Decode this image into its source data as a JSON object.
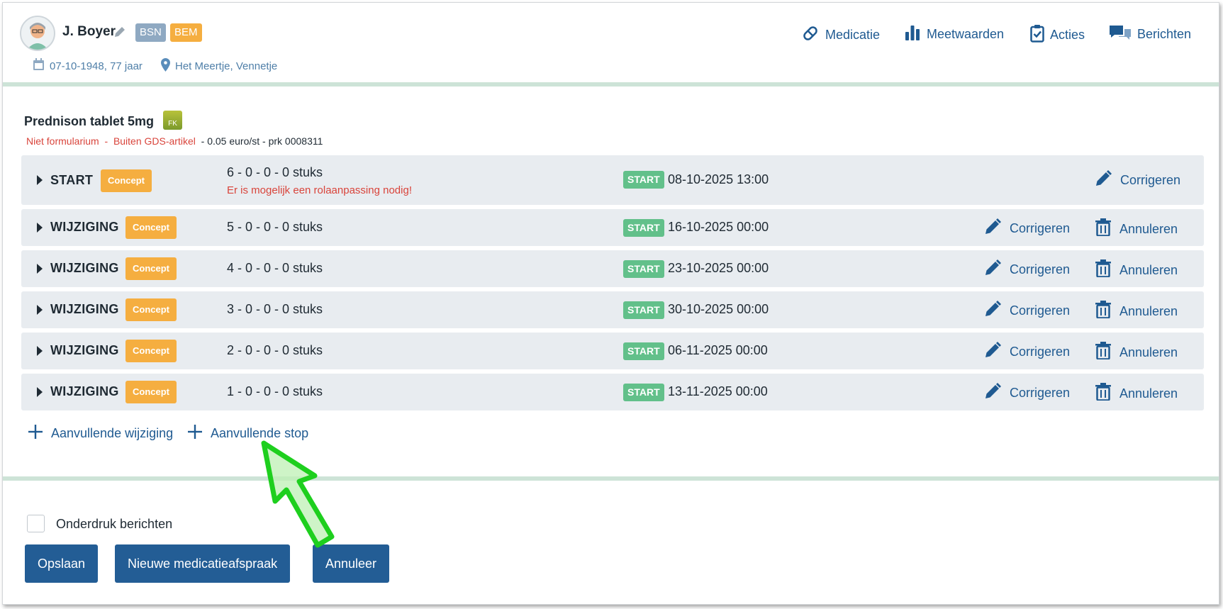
{
  "patient": {
    "name": "J. Boyer",
    "badges": [
      "BSN",
      "BEM"
    ],
    "birth": "07-10-1948, 77 jaar",
    "location": "Het Meertje, Vennetje"
  },
  "nav": [
    {
      "label": "Medicatie",
      "icon": "pill-icon"
    },
    {
      "label": "Meetwaarden",
      "icon": "bar-chart-icon"
    },
    {
      "label": "Acties",
      "icon": "clipboard-check-icon"
    },
    {
      "label": "Berichten",
      "icon": "chat-bubbles-icon"
    }
  ],
  "medication": {
    "title": "Prednison tablet 5mg",
    "fk_label": "FK",
    "formularium": "Niet formularium",
    "sep": "-",
    "gds": "Buiten GDS-artikel",
    "price": "- 0.05 euro/st - prk 0008311"
  },
  "rows": [
    {
      "type": "START",
      "status": "Concept",
      "dose": "6 - 0 - 0 - 0 stuks",
      "warning": "Er is mogelijk een rolaanpassing nodig!",
      "start_label": "START",
      "date": "08-10-2025 13:00",
      "edit": "Corrigeren",
      "cancel": ""
    },
    {
      "type": "WIJZIGING",
      "status": "Concept",
      "dose": "5 - 0 - 0 - 0 stuks",
      "warning": "",
      "start_label": "START",
      "date": "16-10-2025 00:00",
      "edit": "Corrigeren",
      "cancel": "Annuleren"
    },
    {
      "type": "WIJZIGING",
      "status": "Concept",
      "dose": "4 - 0 - 0 - 0 stuks",
      "warning": "",
      "start_label": "START",
      "date": "23-10-2025 00:00",
      "edit": "Corrigeren",
      "cancel": "Annuleren"
    },
    {
      "type": "WIJZIGING",
      "status": "Concept",
      "dose": "3 - 0 - 0 - 0 stuks",
      "warning": "",
      "start_label": "START",
      "date": "30-10-2025 00:00",
      "edit": "Corrigeren",
      "cancel": "Annuleren"
    },
    {
      "type": "WIJZIGING",
      "status": "Concept",
      "dose": "2 - 0 - 0 - 0 stuks",
      "warning": "",
      "start_label": "START",
      "date": "06-11-2025 00:00",
      "edit": "Corrigeren",
      "cancel": "Annuleren"
    },
    {
      "type": "WIJZIGING",
      "status": "Concept",
      "dose": "1 - 0 - 0 - 0 stuks",
      "warning": "",
      "start_label": "START",
      "date": "13-11-2025 00:00",
      "edit": "Corrigeren",
      "cancel": "Annuleren"
    }
  ],
  "add_links": {
    "change": "Aanvullende wijziging",
    "stop": "Aanvullende stop"
  },
  "footer": {
    "suppress_label": "Onderdruk berichten",
    "suppress_checked": false,
    "save": "Opslaan",
    "new_agreement": "Nieuwe medicatieafspraak",
    "cancel": "Annuleer"
  },
  "colors": {
    "link": "#1f5a91",
    "concept": "#f5ae40",
    "start": "#62c08a",
    "warning": "#d9443b",
    "button": "#235d95",
    "pointer": "#1ecf1e"
  }
}
